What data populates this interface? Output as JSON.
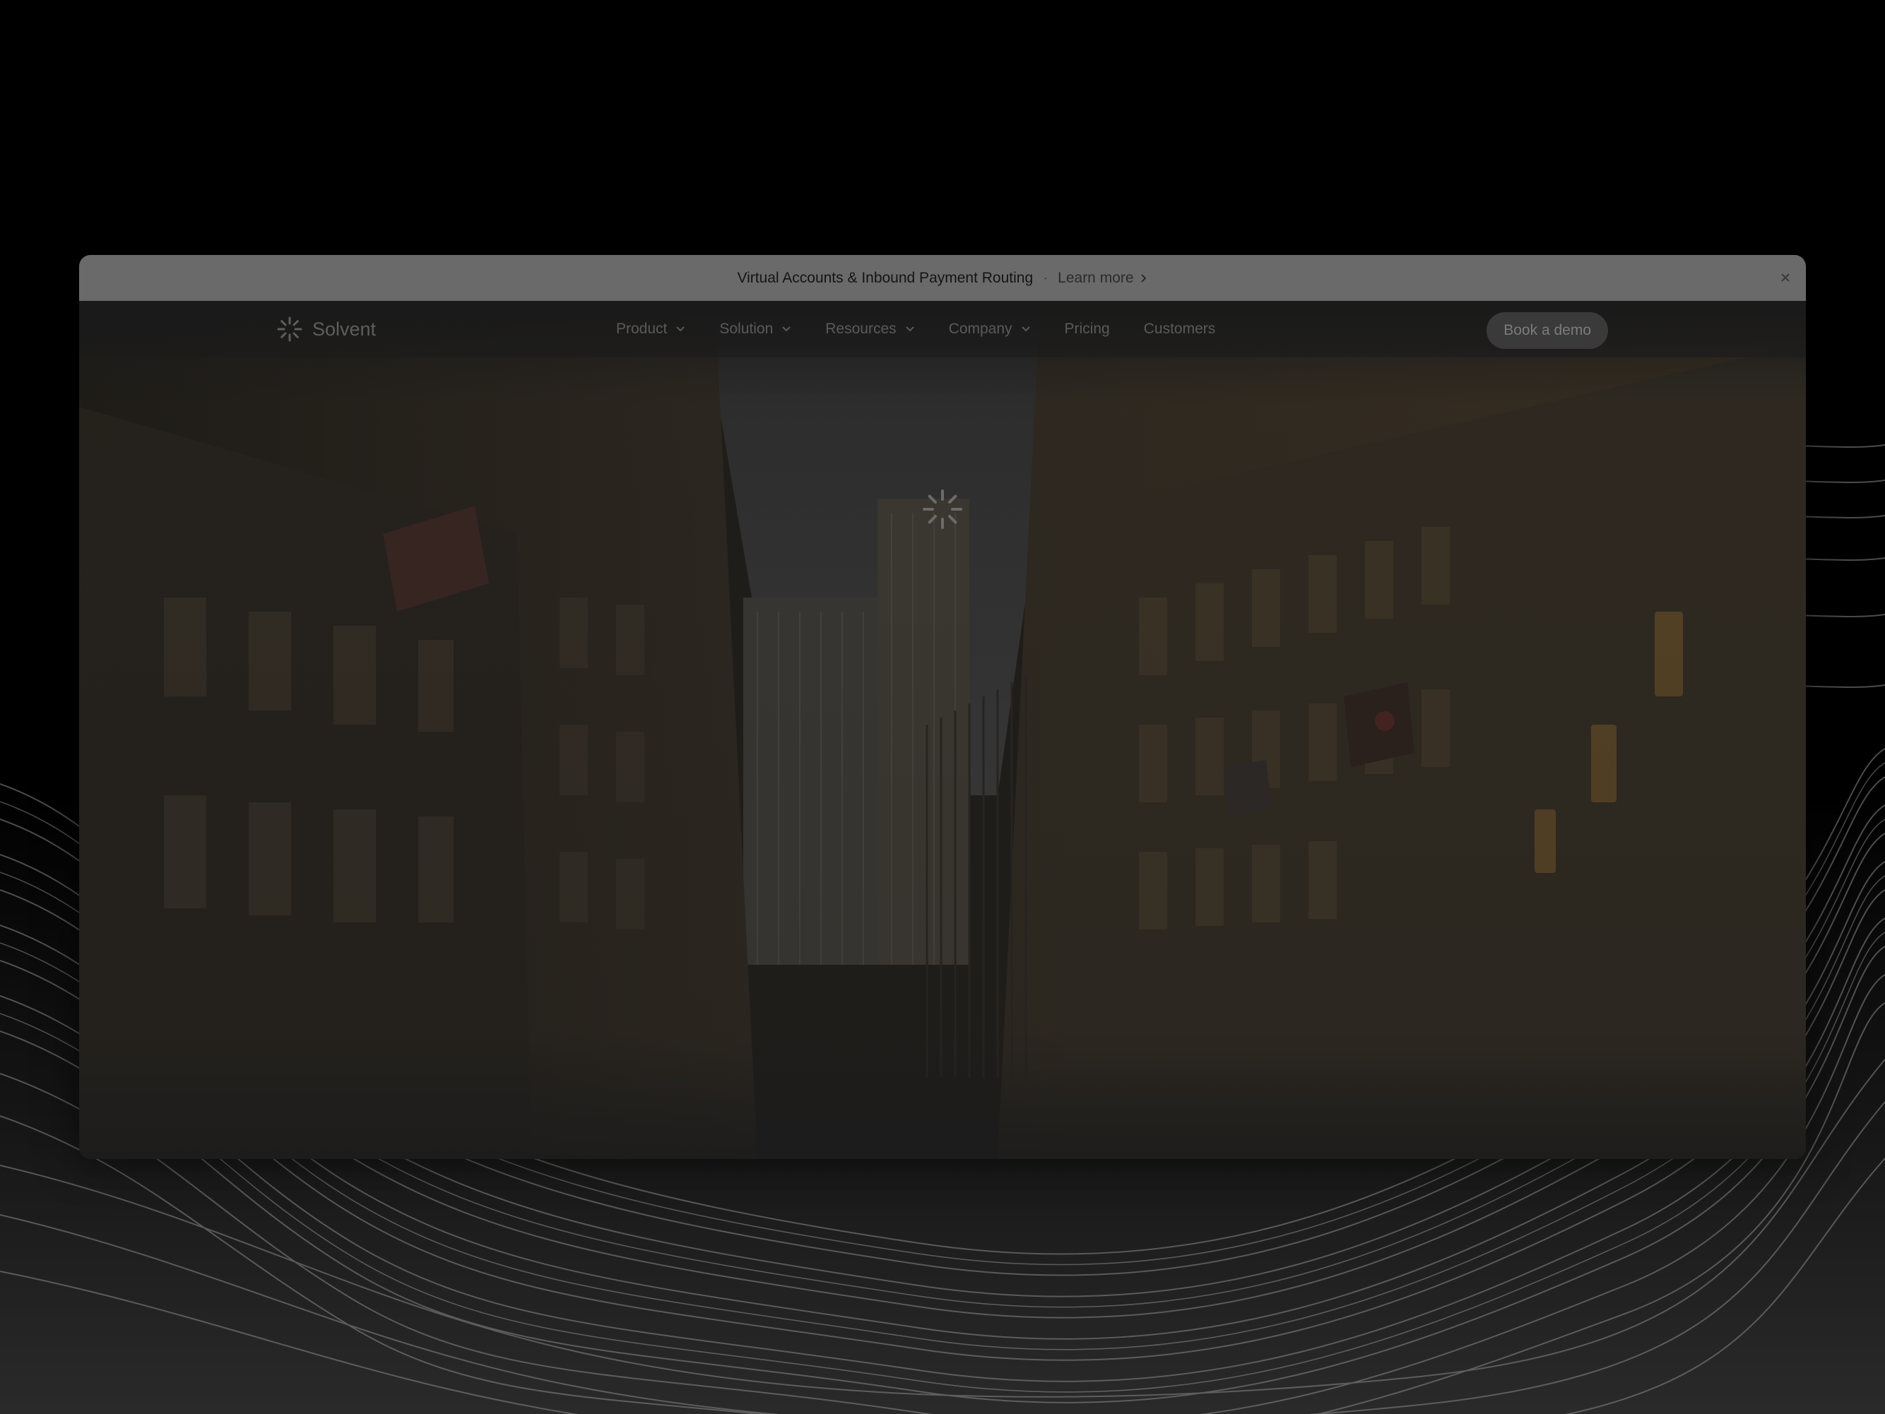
{
  "announcement": {
    "text": "Virtual Accounts & Inbound Payment Routing",
    "separator": "·",
    "link_label": "Learn more",
    "close_icon": "close-icon"
  },
  "brand": {
    "name": "Solvent",
    "logo_icon": "burst-logo-icon"
  },
  "nav": {
    "items": [
      {
        "label": "Product",
        "has_dropdown": true
      },
      {
        "label": "Solution",
        "has_dropdown": true
      },
      {
        "label": "Resources",
        "has_dropdown": true
      },
      {
        "label": "Company",
        "has_dropdown": true
      },
      {
        "label": "Pricing",
        "has_dropdown": false
      },
      {
        "label": "Customers",
        "has_dropdown": false
      }
    ],
    "cta_label": "Book a demo"
  },
  "hero": {
    "loading_icon": "loading-spinner-icon",
    "background": "city street photo"
  },
  "colors": {
    "page_background": "#000000",
    "announcement_bar": "#6a6a6a",
    "window_overlay": "#1c1c1c",
    "cta_background": "#3a3a3a"
  }
}
